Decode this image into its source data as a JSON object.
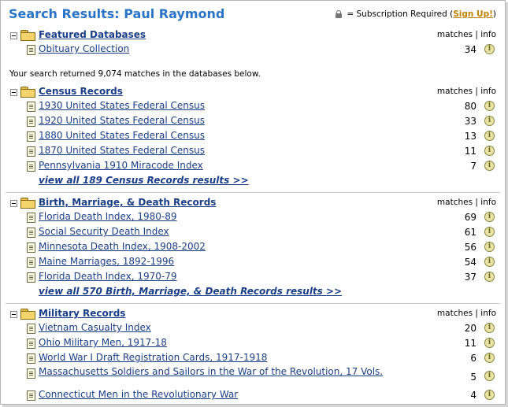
{
  "page": {
    "title": "Search Results: Paul Raymond",
    "subscription_text": "= Subscription Required (",
    "signup_label": "Sign Up!",
    "subscription_close": ")"
  },
  "labels": {
    "matches": "matches",
    "sep": "|",
    "info": "info",
    "info_glyph": "i"
  },
  "featured": {
    "title": "Featured Databases",
    "rows": [
      {
        "name": "Obituary Collection",
        "count": "34"
      }
    ]
  },
  "notice": "Your search returned 9,074 matches in the databases below.",
  "census": {
    "title": "Census Records",
    "rows": [
      {
        "name": "1930 United States Federal Census",
        "count": "80"
      },
      {
        "name": "1920 United States Federal Census",
        "count": "33"
      },
      {
        "name": "1880 United States Federal Census",
        "count": "13"
      },
      {
        "name": "1870 United States Federal Census",
        "count": "11"
      },
      {
        "name": "Pennsylvania 1910 Miracode Index",
        "count": "7"
      }
    ],
    "view_all": "view all 189 Census Records results >>"
  },
  "bmd": {
    "title": "Birth, Marriage, & Death Records",
    "rows": [
      {
        "name": "Florida Death Index, 1980-89",
        "count": "69"
      },
      {
        "name": "Social Security Death Index",
        "count": "61"
      },
      {
        "name": "Minnesota Death Index, 1908-2002",
        "count": "56"
      },
      {
        "name": "Maine Marriages, 1892-1996",
        "count": "54"
      },
      {
        "name": "Florida Death Index, 1970-79",
        "count": "37"
      }
    ],
    "view_all": "view all 570 Birth, Marriage, & Death Records results >>"
  },
  "military": {
    "title": "Military Records",
    "rows": [
      {
        "name": "Vietnam Casualty Index",
        "count": "20"
      },
      {
        "name": "Ohio Military Men, 1917-18",
        "count": "11"
      },
      {
        "name": "World War I Draft Registration Cards, 1917-1918",
        "count": "6"
      },
      {
        "name": "Massachusetts Soldiers and Sailors in the War of the Revolution, 17 Vols.",
        "count": "5"
      },
      {
        "name": "Connecticut Men in the Revolutionary War",
        "count": "4"
      }
    ]
  }
}
